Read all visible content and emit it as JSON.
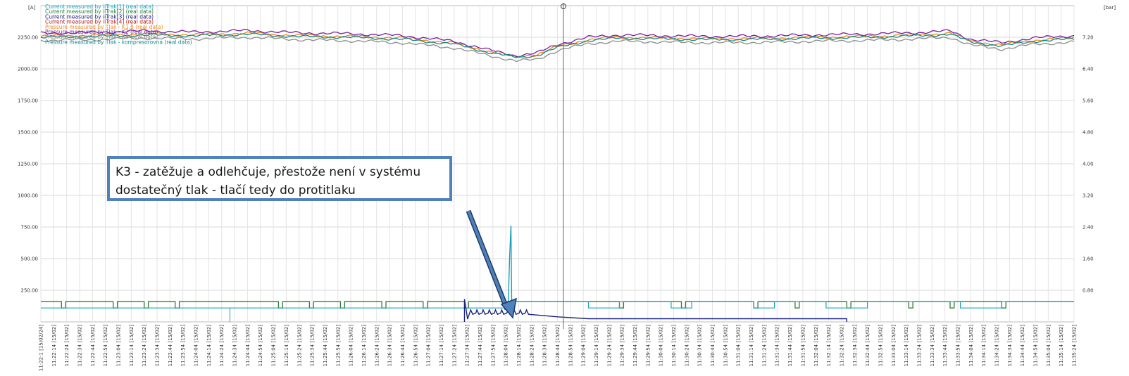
{
  "axes": {
    "left_unit": "[A]",
    "right_unit": "[bar]"
  },
  "legend": [
    {
      "label": "Current measured by iiTrak[1] (real data)",
      "color": "#1aa0b8"
    },
    {
      "label": "Current measured by iiTrak[2] (real data)",
      "color": "#2e7d32"
    },
    {
      "label": "Current measured by iiTrak[3] (real data)",
      "color": "#1a237e"
    },
    {
      "label": "Current measured by iiTrak[4] (real data)",
      "color": "#b71c1c"
    },
    {
      "label": "Pressure measured by Tlak - K1.8 (real data)",
      "color": "#ef8a17"
    },
    {
      "label": "Pressure measured by Tlak - K2 (real data)",
      "color": "#7b1fa2"
    },
    {
      "label": "Pressure measured by Tlak - K3 (real data)",
      "color": "#8c8c8c"
    },
    {
      "label": "Pressure measured by Tlak - kompresorovna (real data)",
      "color": "#138a8a"
    }
  ],
  "annotation": {
    "line1": "K3 - zatěžuje a odlehčuje, přestože není v systému",
    "line2": "dostatečný tlak - tlačí tedy do protitlaku"
  },
  "chart_data": {
    "type": "line",
    "y_left": {
      "label": "[A]",
      "range": [
        0,
        2500
      ],
      "ticks": [
        "250.00",
        "500.00",
        "750.00",
        "1000.00",
        "1250.00",
        "1500.00",
        "1750.00",
        "2000.00",
        "2250.00"
      ]
    },
    "y_right": {
      "label": "[bar]",
      "range": [
        0,
        8
      ],
      "ticks": [
        "0.80",
        "1.60",
        "2.40",
        "3.20",
        "4.00",
        "4.80",
        "5.60",
        "6.40",
        "7.20"
      ]
    },
    "x_range": [
      "11:22:1",
      "11:35:2"
    ],
    "x_ticks": [
      "11:22:1 [15/02/24]",
      "11:22:14 [15/02]",
      "11:22:24 [15/02]",
      "11:22:34 [15/02]",
      "11:22:44 [15/02]",
      "11:22:54 [15/02]",
      "11:23:04 [15/02]",
      "11:23:14 [15/02]",
      "11:23:24 [15/02]",
      "11:23:34 [15/02]",
      "11:23:44 [15/02]",
      "11:23:54 [15/02]",
      "11:24:04 [15/02]",
      "11:24:14 [15/02]",
      "11:24:24 [15/02]",
      "11:24:34 [15/02]",
      "11:24:44 [15/02]",
      "11:24:54 [15/02]",
      "11:25:04 [15/02]",
      "11:25:14 [15/02]",
      "11:25:24 [15/02]",
      "11:25:34 [15/02]",
      "11:25:44 [15/02]",
      "11:25:54 [15/02]",
      "11:26:04 [15/02]",
      "11:26:14 [15/02]",
      "11:26:24 [15/02]",
      "11:26:34 [15/02]",
      "11:26:44 [15/02]",
      "11:26:54 [15/02]",
      "11:27:04 [15/02]",
      "11:27:14 [15/02]",
      "11:27:24 [15/02]",
      "11:27:34 [15/02]",
      "11:27:44 [15/02]",
      "11:27:54 [15/02]",
      "11:28:04 [15/02]",
      "11:28:14 [15/02]",
      "11:28:24 [15/02]",
      "11:28:34 [15/02]",
      "11:28:44 [15/02]",
      "11:28:54 [15/02]",
      "11:29:04 [15/02]",
      "11:29:14 [15/02]",
      "11:29:24 [15/02]",
      "11:29:34 [15/02]",
      "11:29:44 [15/02]",
      "11:29:54 [15/02]",
      "11:30:04 [15/02]",
      "11:30:14 [15/02]",
      "11:30:24 [15/02]",
      "11:30:34 [15/02]",
      "11:30:44 [15/02]",
      "11:30:54 [15/02]",
      "11:31:04 [15/02]",
      "11:31:14 [15/02]",
      "11:31:24 [15/02]",
      "11:31:34 [15/02]",
      "11:31:44 [15/02]",
      "11:31:54 [15/02]",
      "11:32:04 [15/02]",
      "11:32:14 [15/02]",
      "11:32:24 [15/02]",
      "11:32:34 [15/02]",
      "11:32:44 [15/02]",
      "11:32:54 [15/02]",
      "11:33:04 [15/02]",
      "11:33:14 [15/02]",
      "11:33:24 [15/02]",
      "11:33:34 [15/02]",
      "11:33:44 [15/02]",
      "11:33:54 [15/02]",
      "11:34:04 [15/02]",
      "11:34:14 [15/02]",
      "11:34:24 [15/02]",
      "11:34:34 [15/02]",
      "11:34:44 [15/02]",
      "11:34:54 [15/02]",
      "11:35:04 [15/02]",
      "11:35:14 [15/02]",
      "11:35:24 [15/02]"
    ],
    "pressure_points_x": [
      0,
      0.05,
      0.1,
      0.15,
      0.2,
      0.25,
      0.3,
      0.35,
      0.4,
      0.43,
      0.46,
      0.48,
      0.5,
      0.53,
      0.56,
      0.6,
      0.65,
      0.7,
      0.75,
      0.8,
      0.85,
      0.88,
      0.9,
      0.93,
      0.96,
      1.0
    ],
    "series": [
      {
        "name": "Pressure measured by Tlak - K1.8 (real data)",
        "axis": "right",
        "color": "#ef8a17",
        "values": [
          7.22,
          7.25,
          7.28,
          7.26,
          7.3,
          7.24,
          7.22,
          7.18,
          7.05,
          6.86,
          6.7,
          6.76,
          6.96,
          7.14,
          7.2,
          7.18,
          7.16,
          7.17,
          7.2,
          7.22,
          7.26,
          7.3,
          7.1,
          7.0,
          7.12,
          7.18
        ]
      },
      {
        "name": "Pressure measured by Tlak - K2 (real data)",
        "axis": "right",
        "color": "#7b1fa2",
        "values": [
          7.3,
          7.32,
          7.36,
          7.33,
          7.37,
          7.31,
          7.29,
          7.24,
          7.1,
          6.9,
          6.73,
          6.8,
          7.02,
          7.2,
          7.26,
          7.24,
          7.22,
          7.23,
          7.26,
          7.28,
          7.32,
          7.36,
          7.15,
          7.06,
          7.18,
          7.24
        ]
      },
      {
        "name": "Pressure measured by Tlak - K3 (real data)",
        "axis": "right",
        "color": "#8c8c8c",
        "values": [
          7.12,
          7.14,
          7.18,
          7.16,
          7.2,
          7.14,
          7.11,
          7.06,
          6.93,
          6.76,
          6.6,
          6.64,
          6.86,
          7.04,
          7.1,
          7.08,
          7.06,
          7.07,
          7.1,
          7.12,
          7.16,
          7.2,
          7.0,
          6.9,
          7.02,
          7.08
        ]
      },
      {
        "name": "Pressure measured by Tlak - kompresorovna (real data)",
        "axis": "right",
        "color": "#138a8a",
        "values": [
          7.2,
          7.22,
          7.26,
          7.24,
          7.28,
          7.22,
          7.2,
          7.15,
          7.03,
          6.84,
          6.69,
          6.74,
          6.94,
          7.12,
          7.18,
          7.16,
          7.14,
          7.15,
          7.18,
          7.2,
          7.24,
          7.28,
          7.08,
          6.98,
          7.1,
          7.16
        ]
      },
      {
        "name": "Current measured by iiTrak[2] (real data)",
        "axis": "left",
        "color": "#2e7d32",
        "values_level_A": [
          160,
          110
        ],
        "description_type": "step"
      },
      {
        "name": "Current measured by iiTrak[1] (real data)",
        "axis": "left",
        "color": "#1aa0b8",
        "values_level_A": [
          110,
          160
        ],
        "peak_A": 760
      },
      {
        "name": "Current measured by iiTrak[3] (real data)",
        "axis": "left",
        "color": "#1a237e",
        "values_level_A": [
          180,
          60,
          30,
          0
        ]
      }
    ]
  }
}
